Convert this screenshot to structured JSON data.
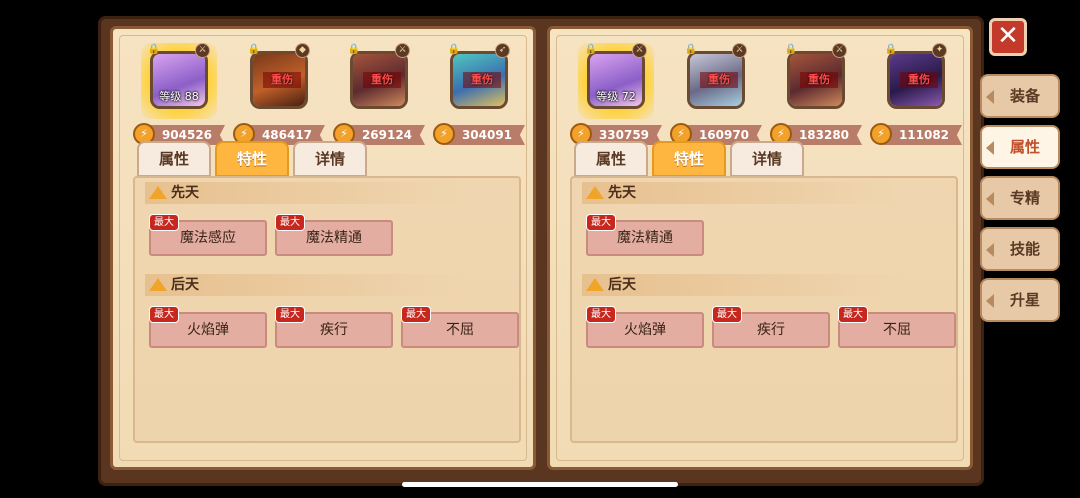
{
  "close_label": "✕",
  "side_tabs": [
    {
      "label": "装备",
      "active": false
    },
    {
      "label": "属性",
      "active": true
    },
    {
      "label": "专精",
      "active": false
    },
    {
      "label": "技能",
      "active": false
    },
    {
      "label": "升星",
      "active": false
    }
  ],
  "panels": [
    {
      "heroes": [
        {
          "power": "904526",
          "level_label": "等级 88",
          "injury": "",
          "selected": true
        },
        {
          "power": "486417",
          "level_label": "",
          "injury": "重伤",
          "selected": false
        },
        {
          "power": "269124",
          "level_label": "",
          "injury": "重伤",
          "selected": false
        },
        {
          "power": "304091",
          "level_label": "",
          "injury": "重伤",
          "selected": false
        }
      ],
      "tabs": [
        "属性",
        "特性",
        "详情"
      ],
      "active_tab": "特性",
      "innate_title": "先天",
      "innate_traits": [
        "魔法感应",
        "魔法精通"
      ],
      "acquired_title": "后天",
      "acquired_traits": [
        "火焰弹",
        "疾行",
        "不屈"
      ],
      "max_label": "最大"
    },
    {
      "heroes": [
        {
          "power": "330759",
          "level_label": "等级 72",
          "injury": "",
          "selected": true
        },
        {
          "power": "160970",
          "level_label": "",
          "injury": "重伤",
          "selected": false
        },
        {
          "power": "183280",
          "level_label": "",
          "injury": "重伤",
          "selected": false
        },
        {
          "power": "111082",
          "level_label": "",
          "injury": "重伤",
          "selected": false
        }
      ],
      "tabs": [
        "属性",
        "特性",
        "详情"
      ],
      "active_tab": "特性",
      "innate_title": "先天",
      "innate_traits": [
        "魔法精通"
      ],
      "acquired_title": "后天",
      "acquired_traits": [
        "火焰弹",
        "疾行",
        "不屈"
      ],
      "max_label": "最大"
    }
  ],
  "colors": {
    "accent_tab": "#ffb640",
    "max_badge": "#c8271e",
    "power_bar": "#b97c69"
  },
  "icons": [
    "lock-icon",
    "power-icon",
    "warning-triangle-icon",
    "close-icon"
  ]
}
